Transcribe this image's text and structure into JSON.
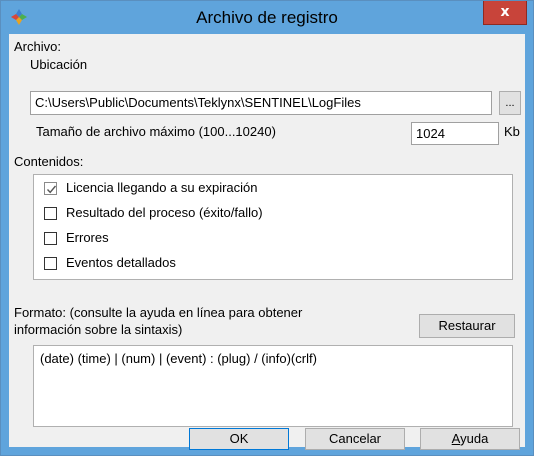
{
  "window": {
    "title": "Archivo de registro",
    "close_glyph": "x",
    "icon": "teklynx-app-icon"
  },
  "archivo": {
    "section_label": "Archivo:",
    "location_label": "Ubicación",
    "location_value": "C:\\Users\\Public\\Documents\\Teklynx\\SENTINEL\\LogFiles",
    "browse_label": "...",
    "max_size_label": "Tamaño de archivo máximo (100...10240)",
    "max_size_value": "1024",
    "size_unit": "Kb"
  },
  "contents": {
    "section_label": "Contenidos:",
    "items": [
      {
        "label": "Licencia llegando a su expiración",
        "checked": true
      },
      {
        "label": "Resultado del proceso (éxito/fallo)",
        "checked": false
      },
      {
        "label": "Errores",
        "checked": false
      },
      {
        "label": "Eventos detallados",
        "checked": false
      }
    ]
  },
  "format": {
    "label_line1": "Formato: (consulte la ayuda en línea para obtener",
    "label_line2": "información sobre la sintaxis)",
    "reset_label": "Restaurar",
    "value": "(date) (time) | (num) | (event) : (plug) / (info)(crlf)"
  },
  "footer": {
    "ok_label": "OK",
    "cancel_label": "Cancelar",
    "help_label_first": "A",
    "help_label_rest": "yuda"
  },
  "colors": {
    "titlebar": "#5fa4dc",
    "close_button": "#c8443a",
    "client_bg": "#f0f0f0"
  }
}
